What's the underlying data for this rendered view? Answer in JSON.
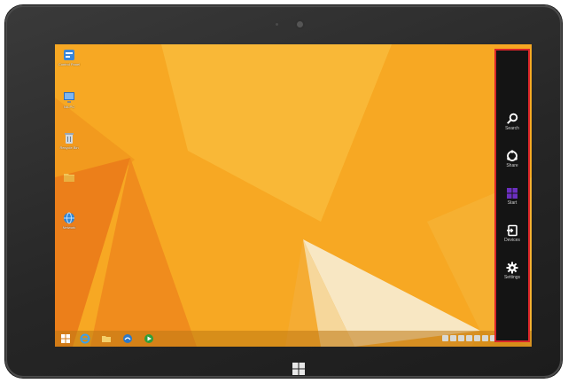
{
  "desktop": {
    "icons": [
      {
        "label": "Control Panel",
        "icon": "control-panel-icon"
      },
      {
        "label": "NA.PC",
        "icon": "computer-icon"
      },
      {
        "label": "Recycle Bin",
        "icon": "recycle-bin-icon"
      },
      {
        "label": "",
        "icon": "folder-icon"
      },
      {
        "label": "Network",
        "icon": "network-icon"
      }
    ],
    "wallpaper": {
      "base": "#f7a823",
      "light": "#fbc449",
      "accent": "#e9791c",
      "cream": "#f8e7c3"
    }
  },
  "taskbar": {
    "items": [
      "start-icon",
      "internet-explorer-icon",
      "file-explorer-icon",
      "store-icon",
      "media-player-icon"
    ]
  },
  "charms": {
    "items": [
      {
        "label": "Search",
        "icon": "search-icon"
      },
      {
        "label": "Share",
        "icon": "share-icon"
      },
      {
        "label": "Start",
        "icon": "windows-logo-icon"
      },
      {
        "label": "Devices",
        "icon": "devices-icon"
      },
      {
        "label": "Settings",
        "icon": "settings-gear-icon"
      }
    ],
    "highlight_color": "#d9262a",
    "background": "#141414",
    "start_tile_color": "#6b2fbf"
  }
}
